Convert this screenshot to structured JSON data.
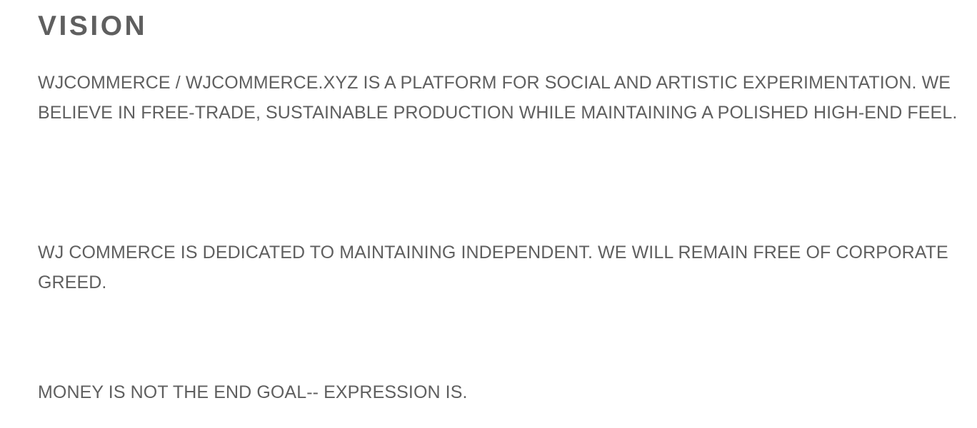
{
  "vision": {
    "title": "VISION",
    "paragraphs": [
      "WJCOMMERCE / WJCOMMERCE.XYZ IS A PLATFORM FOR SOCIAL AND ARTISTIC EXPERIMENTATION. WE BELIEVE IN FREE-TRADE, SUSTAINABLE PRODUCTION WHILE MAINTAINING A POLISHED HIGH-END FEEL.",
      "WJ COMMERCE IS DEDICATED TO MAINTAINING INDEPENDENT. WE WILL REMAIN FREE OF CORPORATE GREED.",
      "MONEY IS NOT THE END GOAL-- EXPRESSION IS."
    ]
  },
  "colors": {
    "text": "#5f5f5f",
    "background": "#ffffff"
  }
}
